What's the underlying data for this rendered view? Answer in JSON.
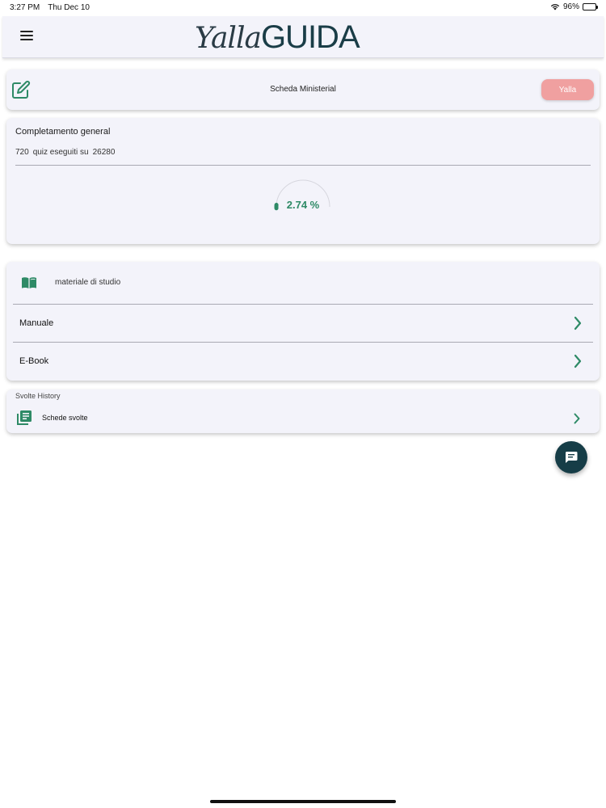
{
  "status_bar": {
    "time": "3:27 PM",
    "date": "Thu Dec 10",
    "battery": "96%",
    "battery_level": 0.96
  },
  "header": {
    "logo_script": "Yalla",
    "logo_block": "GUIDA"
  },
  "quiz_card": {
    "title": "Scheda Ministerial",
    "button_label": "Yalla"
  },
  "progress_card": {
    "title": "Completamento general",
    "done": "720",
    "middle_text": "quiz eseguiti su",
    "total": "26280",
    "percent_label": "2.74 %",
    "percent_value": 2.74
  },
  "study_card": {
    "title": "materiale di studio",
    "items": [
      {
        "label": "Manuale"
      },
      {
        "label": "E-Book"
      }
    ]
  },
  "history_card": {
    "title": "Svolte History",
    "item_label": "Schede svolte"
  },
  "colors": {
    "accent_green": "#2e8a66",
    "brand_dark": "#163d47",
    "button_pink": "#f0a0a0",
    "card_bg": "#f3f3fa"
  }
}
